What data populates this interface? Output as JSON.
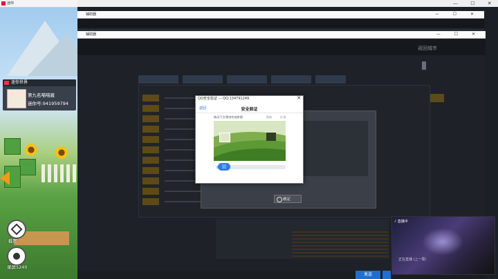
{
  "game": {
    "title": "迷你",
    "player": {
      "section_label": "迷你世界",
      "name": "第九名喵喵酱",
      "id": "迷你号:941959794"
    },
    "crop_label": "截图",
    "record_label": "录屏5240"
  },
  "launcher": {
    "back_window_title": "辅助器",
    "front_window_title": "辅助器",
    "back_to_city": "返回城市",
    "window_controls": "— ☐ ✕"
  },
  "dialog": {
    "title": "QQ安全验证 — QQ:134791249",
    "back": "返回",
    "heading": "安全验证",
    "instruction": "拖动下方滑块完成拼图",
    "refresh": "刷新",
    "feedback": "反馈",
    "slider_handle": "|||",
    "close": "✕"
  },
  "behind_dialog": {
    "confirm": "确定"
  },
  "bottom_bar": {
    "send": "发送"
  },
  "stream": {
    "label": "♪ 直播中",
    "bottom_text": "正在直播 (上一局)"
  },
  "os": {
    "controls": "— ☐ ✕"
  }
}
